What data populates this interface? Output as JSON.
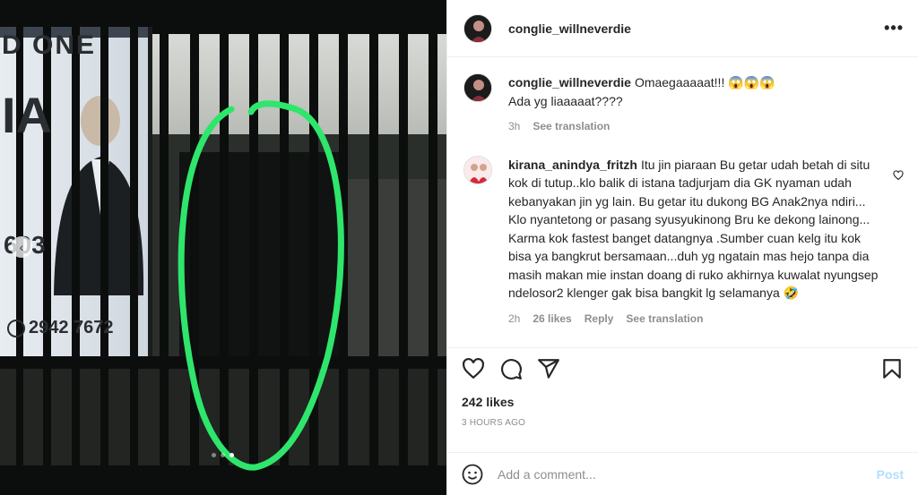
{
  "post": {
    "author": "conglie_willneverdie",
    "more_icon": "ellipsis-icon"
  },
  "media": {
    "banner_line1": "D ONE",
    "banner_big": "IA",
    "banner_num": "603",
    "banner_phone": "2942 7672",
    "slide_count": 3,
    "active_slide": 2,
    "annotation_color": "#2ee66b"
  },
  "caption": {
    "username": "conglie_willneverdie",
    "text_line1": "Omaegaaaaat!!! 😱😱😱",
    "text_line2": "Ada yg liaaaaat????",
    "time": "3h",
    "see_translation": "See translation"
  },
  "comment": {
    "username": "kirana_anindya_fritzh",
    "text": "Itu jin piaraan Bu getar udah betah di situ kok di tutup..klo balik di istana tadjurjam dia GK nyaman udah kebanyakan jin yg lain. Bu getar itu dukong BG Anak2nya ndiri... Klo nyantetong or pasang syusyukinong Bru ke dekong lainong... Karma kok fastest banget datangnya .Sumber cuan kelg itu kok bisa ya bangkrut bersamaan...duh yg ngatain mas hejo tanpa dia masih makan mie instan doang di ruko akhirnya kuwalat nyungsep ndelosor2 klenger gak bisa bangkit lg selamanya 🤣",
    "time": "2h",
    "likes": "26 likes",
    "reply": "Reply",
    "see_translation": "See translation"
  },
  "actions": {
    "likes": "242 likes",
    "timestamp": "3 HOURS AGO"
  },
  "composer": {
    "placeholder": "Add a comment...",
    "post_label": "Post"
  },
  "colors": {
    "post_disabled": "#b2dffc",
    "muted": "#8e8e8e",
    "text": "#262626"
  }
}
